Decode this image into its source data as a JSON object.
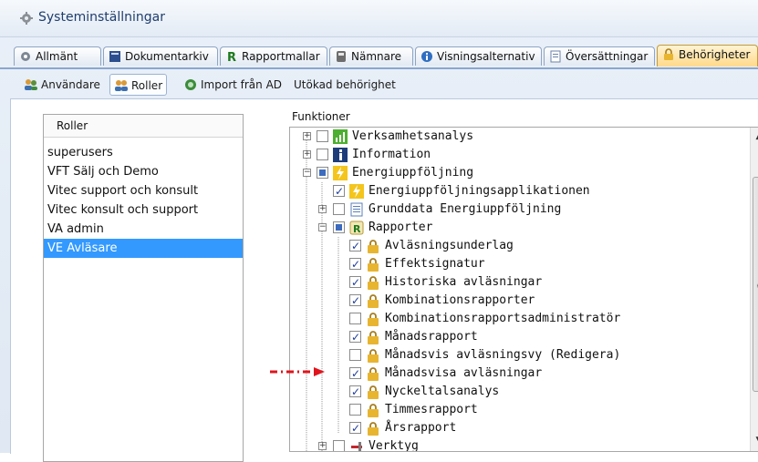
{
  "window": {
    "title": "Systeminställningar",
    "title_icon": "gear-icon"
  },
  "main_tabs": [
    {
      "label": "Allmänt",
      "icon": "gear-icon"
    },
    {
      "label": "Dokumentarkiv",
      "icon": "book-icon"
    },
    {
      "label": "Rapportmallar",
      "icon": "report-r-icon"
    },
    {
      "label": "Nämnare",
      "icon": "calculator-icon"
    },
    {
      "label": "Visningsalternativ",
      "icon": "info-icon"
    },
    {
      "label": "Översättningar",
      "icon": "document-icon"
    },
    {
      "label": "Behörigheter",
      "icon": "lock-icon",
      "active": true
    }
  ],
  "sub_tabs": [
    {
      "label": "Användare",
      "icon": "users-icon"
    },
    {
      "label": "Roller",
      "icon": "roles-icon",
      "active": true
    },
    {
      "label": "Import från AD",
      "icon": "import-icon"
    },
    {
      "label": "Utökad behörighet",
      "icon": ""
    }
  ],
  "roles": {
    "header": "Roller",
    "items": [
      "superusers",
      "VFT Sälj och Demo",
      "Vitec support och konsult",
      "Vitec konsult och support",
      "VA admin",
      "VE Avläsare"
    ],
    "selected": "VE Avläsare"
  },
  "functions": {
    "label": "Funktioner",
    "rows": [
      {
        "text": "Verksamhetsanalys",
        "level": 0,
        "expander": "+",
        "checkbox": "unchecked",
        "icon": "chart-icon"
      },
      {
        "text": "Information",
        "level": 0,
        "expander": "+",
        "checkbox": "unchecked",
        "icon": "info-icon"
      },
      {
        "text": "Energiuppföljning",
        "level": 0,
        "expander": "-",
        "checkbox": "partial",
        "icon": "lightning-icon"
      },
      {
        "text": "Energiuppföljningsapplikationen",
        "level": 1,
        "expander": "",
        "checkbox": "checked",
        "icon": "lightning-icon"
      },
      {
        "text": "Grunddata Energiuppföljning",
        "level": 1,
        "expander": "+",
        "checkbox": "unchecked",
        "icon": "document-icon"
      },
      {
        "text": "Rapporter",
        "level": 1,
        "expander": "-",
        "checkbox": "partial",
        "icon": "report-r-icon"
      },
      {
        "text": "Avläsningsunderlag",
        "level": 2,
        "expander": "",
        "checkbox": "checked",
        "icon": "lock-icon"
      },
      {
        "text": "Effektsignatur",
        "level": 2,
        "expander": "",
        "checkbox": "checked",
        "icon": "lock-icon"
      },
      {
        "text": "Historiska avläsningar",
        "level": 2,
        "expander": "",
        "checkbox": "checked",
        "icon": "lock-icon"
      },
      {
        "text": "Kombinationsrapporter",
        "level": 2,
        "expander": "",
        "checkbox": "checked",
        "icon": "lock-icon"
      },
      {
        "text": "Kombinationsrapportsadministratör",
        "level": 2,
        "expander": "",
        "checkbox": "unchecked",
        "icon": "lock-icon"
      },
      {
        "text": "Månadsrapport",
        "level": 2,
        "expander": "",
        "checkbox": "checked",
        "icon": "lock-icon"
      },
      {
        "text": "Månadsvis avläsningsvy (Redigera)",
        "level": 2,
        "expander": "",
        "checkbox": "unchecked",
        "icon": "lock-icon"
      },
      {
        "text": "Månadsvisa avläsningar",
        "level": 2,
        "expander": "",
        "checkbox": "checked",
        "icon": "lock-icon"
      },
      {
        "text": "Nyckeltalsanalys",
        "level": 2,
        "expander": "",
        "checkbox": "checked",
        "icon": "lock-icon"
      },
      {
        "text": "Timmesrapport",
        "level": 2,
        "expander": "",
        "checkbox": "unchecked",
        "icon": "lock-icon"
      },
      {
        "text": "Årsrapport",
        "level": 2,
        "expander": "",
        "checkbox": "checked",
        "icon": "lock-icon"
      },
      {
        "text": "Verktyg",
        "level": 1,
        "expander": "+",
        "checkbox": "unchecked",
        "icon": "tools-icon"
      }
    ]
  },
  "colors": {
    "selection": "#3399ff",
    "active_tab": "#ffd98a",
    "arrow": "#e0141c"
  }
}
